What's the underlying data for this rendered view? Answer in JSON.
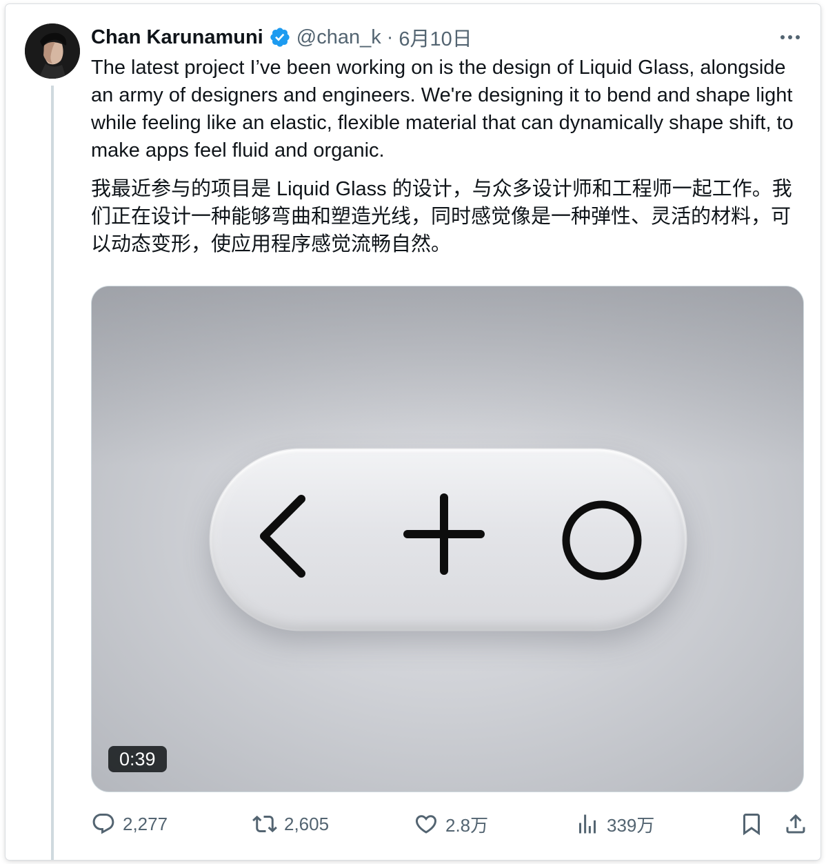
{
  "author": {
    "name": "Chan Karunamuni",
    "handle": "@chan_k",
    "separator": "·",
    "date": "6月10日"
  },
  "tweet": {
    "text_en": "The latest project I’ve been working on is the design of Liquid Glass, alongside an army of designers and engineers. We're designing it to bend and shape light while feeling like an elastic, flexible material that can dynamically shape shift, to make apps feel fluid and organic.",
    "text_zh": "我最近参与的项目是 Liquid Glass 的设计，与众多设计师和工程师一起工作。我们正在设计一种能够弯曲和塑造光线，同时感觉像是一种弹性、灵活的材料，可以动态变形，使应用程序感觉流畅自然。"
  },
  "media": {
    "duration": "0:39",
    "icons": [
      "chevron-left-icon",
      "plus-icon",
      "circle-icon"
    ]
  },
  "actions": {
    "replies": "2,277",
    "reposts": "2,605",
    "likes": "2.8万",
    "views": "339万"
  },
  "colors": {
    "verified": "#1d9bf0",
    "secondary_text": "#536471",
    "primary_text": "#0f1419"
  }
}
